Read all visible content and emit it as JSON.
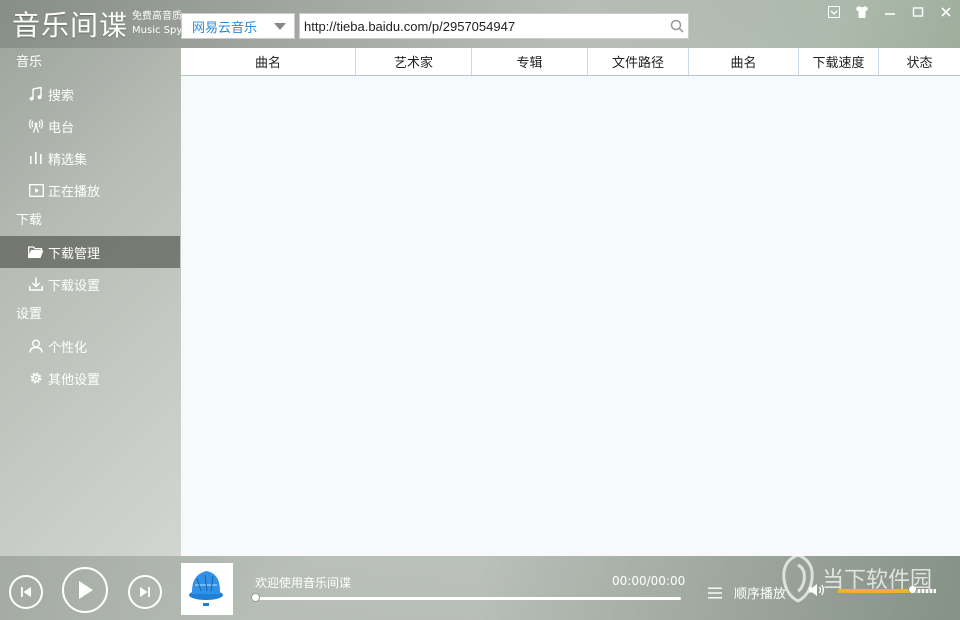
{
  "app": {
    "title_main": "音乐间谍",
    "title_tag": "免费高音质",
    "title_en": "Music Spy"
  },
  "toolbar": {
    "source": "网易云音乐",
    "url": "http://tieba.baidu.com/p/2957054947",
    "icons": [
      "search-icon",
      "skin-icon",
      "shirt-icon",
      "minimize-icon",
      "maximize-icon",
      "close-icon"
    ]
  },
  "sidebar": {
    "sections": [
      {
        "label": "音乐",
        "items": [
          {
            "label": "搜索",
            "icon": "music-note-icon"
          },
          {
            "label": "电台",
            "icon": "radio-icon"
          },
          {
            "label": "精选集",
            "icon": "bars-icon"
          },
          {
            "label": "正在播放",
            "icon": "play-screen-icon"
          }
        ]
      },
      {
        "label": "下载",
        "items": [
          {
            "label": "下载管理",
            "icon": "folder-icon",
            "active": true
          },
          {
            "label": "下载设置",
            "icon": "download-icon"
          }
        ]
      },
      {
        "label": "设置",
        "items": [
          {
            "label": "个性化",
            "icon": "user-icon"
          },
          {
            "label": "其他设置",
            "icon": "gear-icon"
          }
        ]
      }
    ]
  },
  "table": {
    "columns": [
      "曲名",
      "艺术家",
      "专辑",
      "文件路径",
      "曲名",
      "下载速度",
      "状态"
    ],
    "rows": []
  },
  "player": {
    "track": "欢迎使用音乐间谍",
    "time": "00:00/00:00",
    "progress": 0,
    "mode": "顺序播放",
    "volume": 0.75
  },
  "watermark": "当下软件园",
  "colors": {
    "accent": "#2a8ad8",
    "active_item": "#5f625a",
    "volume": "#f0b030"
  }
}
